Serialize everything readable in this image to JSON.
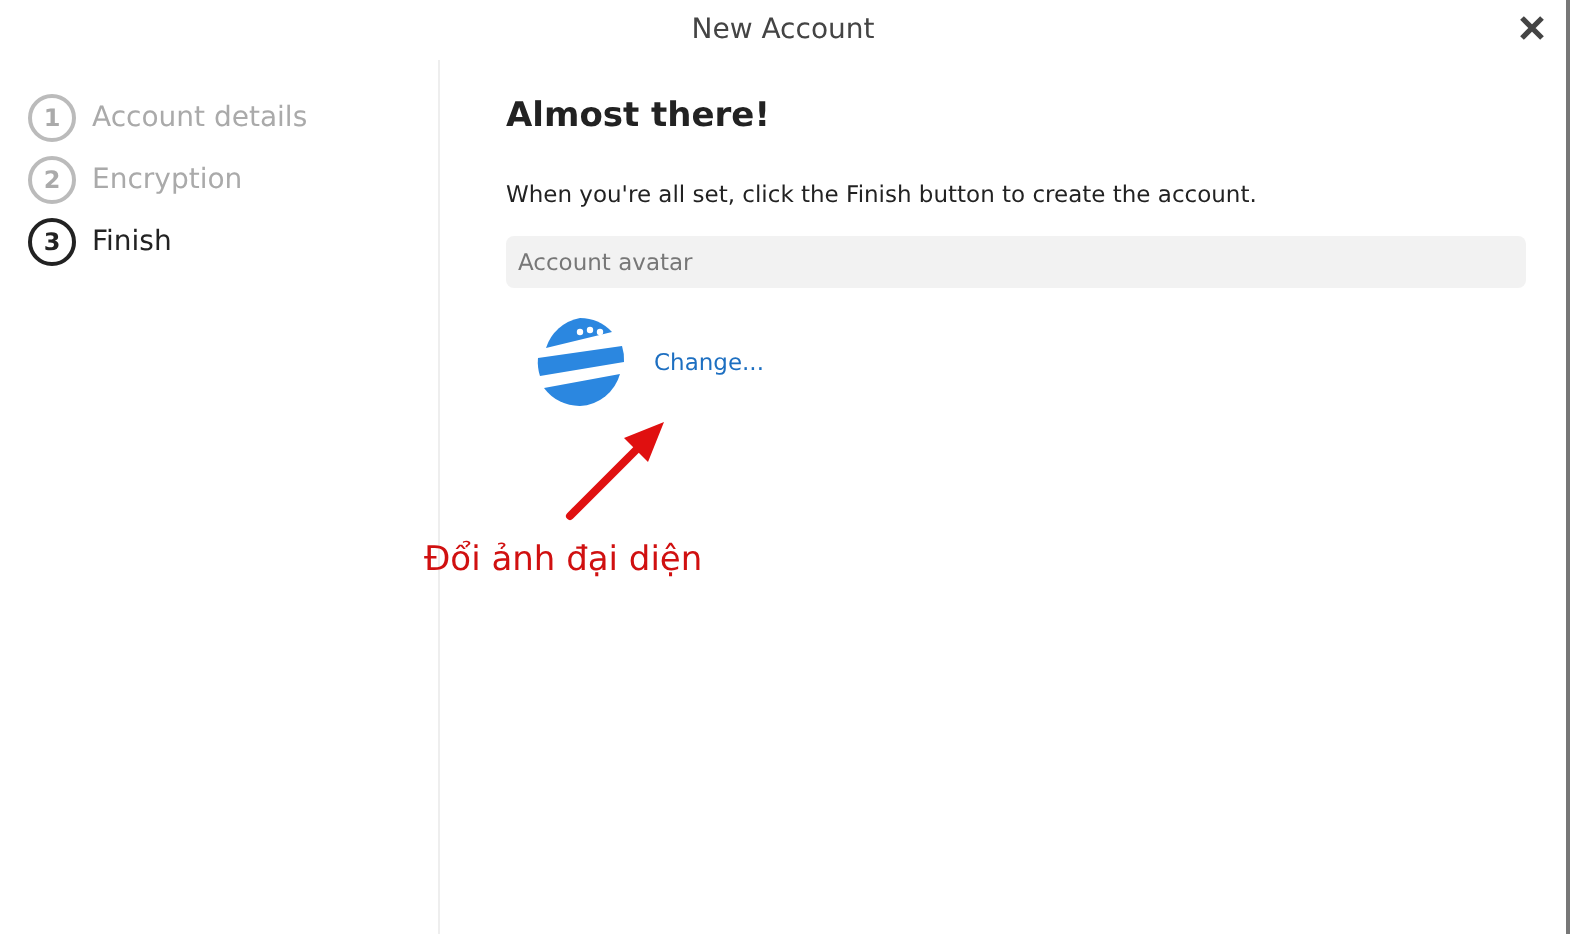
{
  "window": {
    "title": "New Account"
  },
  "steps": [
    {
      "number": "1",
      "label": "Account details",
      "selected": false
    },
    {
      "number": "2",
      "label": "Encryption",
      "selected": false
    },
    {
      "number": "3",
      "label": "Finish",
      "selected": true
    }
  ],
  "content": {
    "heading": "Almost there!",
    "text": "When you're all set, click the Finish button to create the account.",
    "section": "Account avatar",
    "change_link": "Change..."
  },
  "annotation": {
    "text": "Đổi ảnh đại diện"
  }
}
